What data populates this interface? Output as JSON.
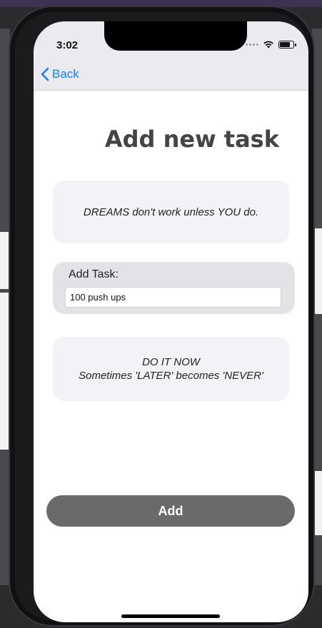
{
  "status_bar": {
    "time": "3:02"
  },
  "nav": {
    "back_label": "Back"
  },
  "page": {
    "title": "Add new task"
  },
  "quotes": {
    "top": "DREAMS don't work unless YOU do.",
    "bottom_line1": "DO IT NOW",
    "bottom_line2": "Sometimes 'LATER' becomes 'NEVER'"
  },
  "task_form": {
    "label": "Add Task:",
    "value": "100 push ups"
  },
  "actions": {
    "add_label": "Add"
  },
  "colors": {
    "accent": "#1a7cf2",
    "button": "#6a6a6a",
    "card": "#f2f2f7"
  },
  "icons": {
    "back": "chevron-left-icon",
    "wifi": "wifi-icon",
    "battery": "battery-icon",
    "signal": "cellular-signal-icon"
  },
  "battery_level": 0.85
}
